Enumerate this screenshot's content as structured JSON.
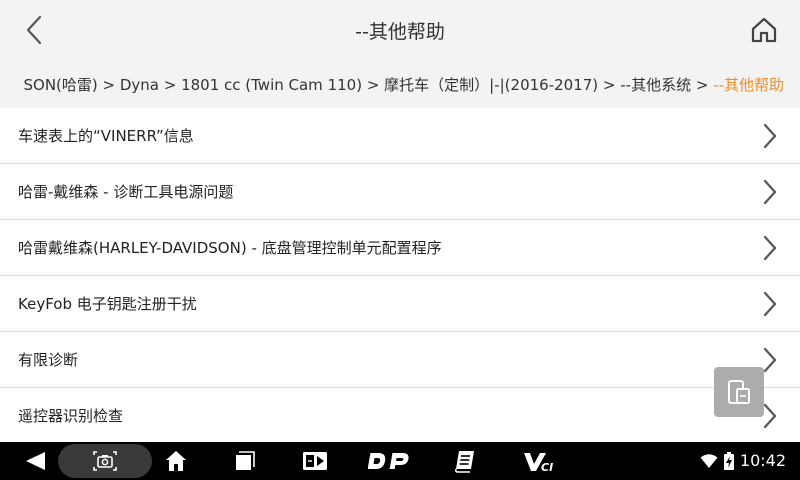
{
  "header": {
    "title": "--其他帮助",
    "back_icon": "chevron-left-icon",
    "home_icon": "home-icon"
  },
  "breadcrumb": {
    "path": "SON(哈雷) > Dyna > 1801 cc (Twin Cam 110) > 摩托车（定制）|-|(2016-2017) > --其他系统 > ",
    "current": "--其他帮助",
    "current_color": "#f28c22"
  },
  "list": {
    "items": [
      {
        "label": "车速表上的“VINERR”信息"
      },
      {
        "label": "哈雷-戴维森 - 诊断工具电源问题"
      },
      {
        "label": "哈雷戴维森(HARLEY-DAVIDSON) - 底盘管理控制单元配置程序"
      },
      {
        "label": "KeyFob 电子钥匙注册干扰"
      },
      {
        "label": "有限诊断"
      },
      {
        "label": "遥控器识别检查"
      }
    ]
  },
  "floating_button": {
    "icon": "split-screen-icon"
  },
  "navbar": {
    "buttons": [
      {
        "icon": "back-triangle-icon"
      },
      {
        "icon": "screenshot-camera-icon"
      },
      {
        "icon": "home-icon"
      },
      {
        "icon": "recent-apps-icon"
      },
      {
        "icon": "media-icon"
      },
      {
        "icon": "dp-icon",
        "label": "DP"
      },
      {
        "icon": "notes-icon"
      },
      {
        "icon": "vci-icon",
        "label": "VCI"
      }
    ],
    "time": "10:42",
    "status_icons": [
      "wifi-icon",
      "battery-charging-icon"
    ]
  },
  "colors": {
    "accent": "#f28c22",
    "header_bg": "#f3f3f3",
    "navbar_bg": "#000000"
  }
}
